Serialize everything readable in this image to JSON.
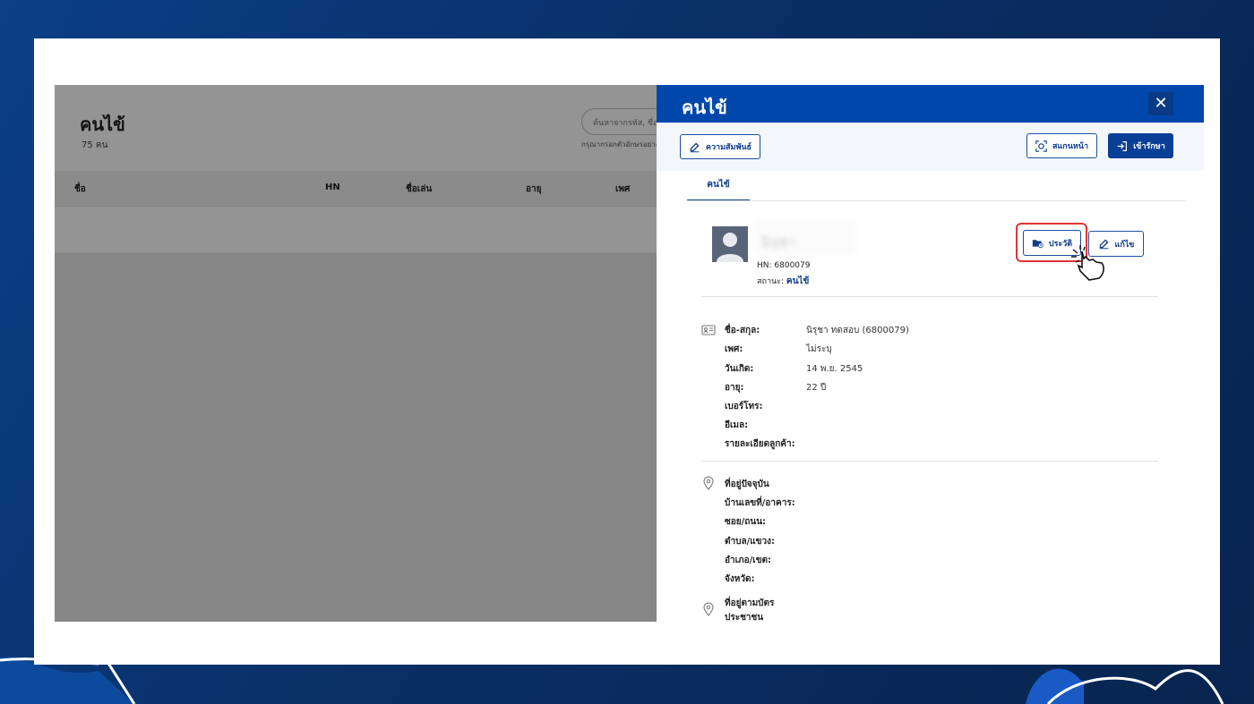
{
  "list_page": {
    "title": "คนไข้",
    "count": "75 คน",
    "search_placeholder": "ค้นหาจากรหัส, ชื่อ",
    "search_hint": "กรุณากรอกตัวอักษรอย่างน้อย",
    "columns": [
      "ชื่อ",
      "HN",
      "ชื่อเล่น",
      "อายุ",
      "เพศ"
    ]
  },
  "panel": {
    "title": "คนไข้",
    "close_icon": "close-icon",
    "toolbar": {
      "relationship_label": "ความสัมพันธ์",
      "scan_label": "สแกนหน้า",
      "admit_label": "เข้ารักษา"
    },
    "tab_label": "คนไข้",
    "profile": {
      "name": "นิรุชา",
      "hn": "HN: 6800079",
      "status_label": "สถานะ:",
      "status_value": "คนไข้",
      "history_label": "ประวัติ",
      "edit_label": "แก้ไข"
    },
    "info": {
      "fields": [
        {
          "label": "ชื่อ-สกุล:",
          "value": "นิรุชา ทดสอบ (6800079)"
        },
        {
          "label": "เพศ:",
          "value": "ไม่ระบุ"
        },
        {
          "label": "วันเกิด:",
          "value": "14 พ.ย. 2545"
        },
        {
          "label": "อายุ:",
          "value": "22 ปี"
        },
        {
          "label": "เบอร์โทร:",
          "value": ""
        },
        {
          "label": "อีเมล:",
          "value": ""
        },
        {
          "label": "รายละเอียดลูกค้า:",
          "value": ""
        }
      ]
    },
    "address": {
      "title": "ที่อยู่ปัจจุบัน",
      "fields": [
        "บ้านเลขที่/อาคาร:",
        "ซอย/ถนน:",
        "ตำบล/แขวง:",
        "อำเภอ/เขต:",
        "จังหวัด:"
      ]
    },
    "id_address": {
      "title_line1": "ที่อยู่ตามบัตร",
      "title_line2": "ประชาชน"
    }
  },
  "colors": {
    "brand": "#0047ab",
    "highlight": "#e23333"
  }
}
